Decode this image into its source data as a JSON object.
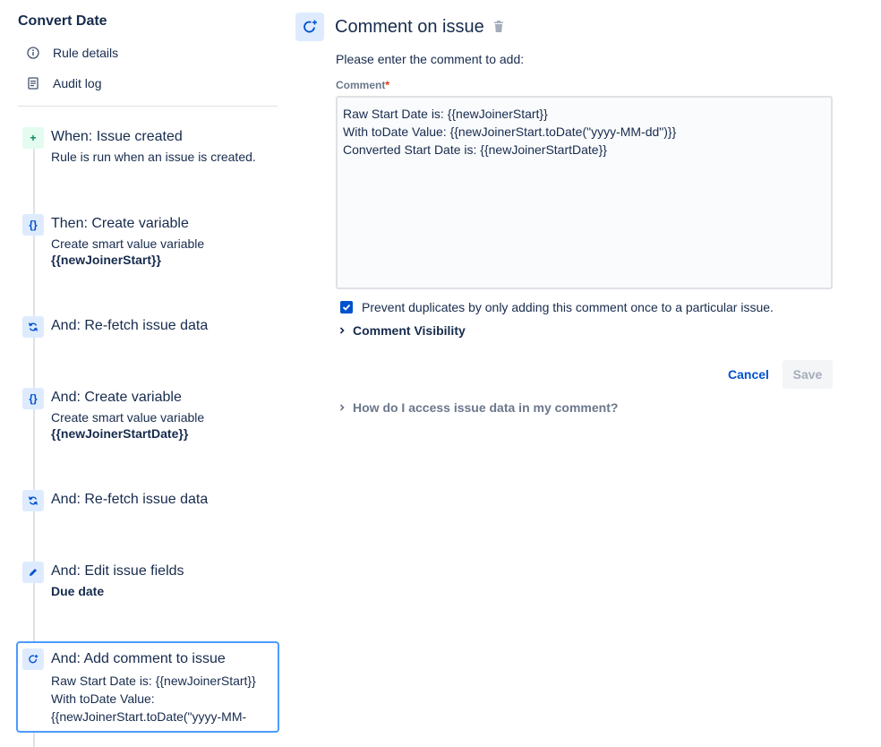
{
  "sidebar": {
    "rule_title": "Convert Date",
    "links": [
      {
        "label": "Rule details",
        "icon": "info-icon"
      },
      {
        "label": "Audit log",
        "icon": "audit-log-icon"
      }
    ],
    "steps": [
      {
        "title": "When: Issue created",
        "desc": "Rule is run when an issue is created.",
        "desc_bold": "",
        "icon": "plus-icon",
        "icon_glyph": "+"
      },
      {
        "title": "Then: Create variable",
        "desc": "Create smart value variable",
        "desc_bold": "{{newJoinerStart}}",
        "icon": "braces-icon",
        "icon_glyph": "{}"
      },
      {
        "title": "And: Re-fetch issue data",
        "desc": "",
        "desc_bold": "",
        "icon": "refresh-icon",
        "icon_glyph": ""
      },
      {
        "title": "And: Create variable",
        "desc": "Create smart value variable",
        "desc_bold": "{{newJoinerStartDate}}",
        "icon": "braces-icon",
        "icon_glyph": "{}"
      },
      {
        "title": "And: Re-fetch issue data",
        "desc": "",
        "desc_bold": "",
        "icon": "refresh-icon",
        "icon_glyph": ""
      },
      {
        "title": "And: Edit issue fields",
        "desc": "",
        "desc_bold": "Due date",
        "icon": "pencil-icon",
        "icon_glyph": ""
      },
      {
        "title": "And: Add comment to issue",
        "desc_line1": "Raw Start Date is: {{newJoinerStart}}",
        "desc_line2": "With toDate Value:",
        "desc_line3": "{{newJoinerStart.toDate(\"yyyy-MM-",
        "icon": "comment-icon",
        "selected": true
      }
    ]
  },
  "main": {
    "title": "Comment on issue",
    "instruction": "Please enter the comment to add:",
    "field_label": "Comment",
    "required_mark": "*",
    "comment_value": "Raw Start Date is: {{newJoinerStart}}\nWith toDate Value: {{newJoinerStart.toDate(\"yyyy-MM-dd\")}}\nConverted Start Date is: {{newJoinerStartDate}}",
    "prevent_duplicates_label": "Prevent duplicates by only adding this comment once to a particular issue.",
    "prevent_duplicates_checked": true,
    "visibility_label": "Comment Visibility",
    "cancel_label": "Cancel",
    "save_label": "Save",
    "help_label": "How do I access issue data in my comment?"
  },
  "colors": {
    "accent": "#0052cc",
    "selected_border": "#4c9aff",
    "trigger_green": "#00875a",
    "text": "#172b4d",
    "subtle_text": "#6b778c"
  }
}
